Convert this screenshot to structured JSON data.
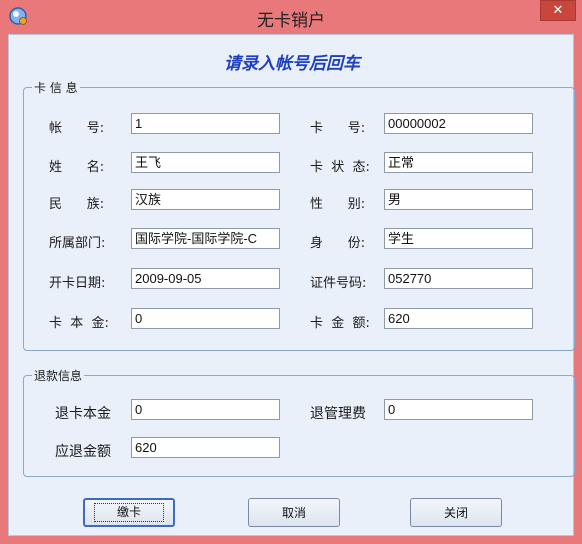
{
  "window": {
    "title": "无卡销户",
    "close_glyph": "✕"
  },
  "heading": "请录入帐号后回车",
  "card_info": {
    "legend": "卡 信 息",
    "left": [
      {
        "label": "帐      号:",
        "value": "1"
      },
      {
        "label": "姓      名:",
        "value": "王飞"
      },
      {
        "label": "民      族:",
        "value": "汉族"
      },
      {
        "label": "所属部门:",
        "value": "国际学院-国际学院-C"
      },
      {
        "label": "开卡日期:",
        "value": "2009-09-05"
      },
      {
        "label": "卡  本  金:",
        "value": "0"
      }
    ],
    "right": [
      {
        "label": "卡      号:",
        "value": "00000002"
      },
      {
        "label": "卡  状  态:",
        "value": "正常"
      },
      {
        "label": "性      别:",
        "value": "男"
      },
      {
        "label": "身      份:",
        "value": "学生"
      },
      {
        "label": "证件号码:",
        "value": "052770"
      },
      {
        "label": "卡  金  额:",
        "value": "620"
      }
    ]
  },
  "refund_info": {
    "legend": "退款信息",
    "card_principal_label": "退卡本金",
    "card_principal_value": "0",
    "management_fee_label": "退管理费",
    "management_fee_value": "0",
    "refund_amount_label": "应退金额",
    "refund_amount_value": "620"
  },
  "buttons": {
    "submit": "缴卡",
    "cancel": "取消",
    "close": "关闭"
  }
}
